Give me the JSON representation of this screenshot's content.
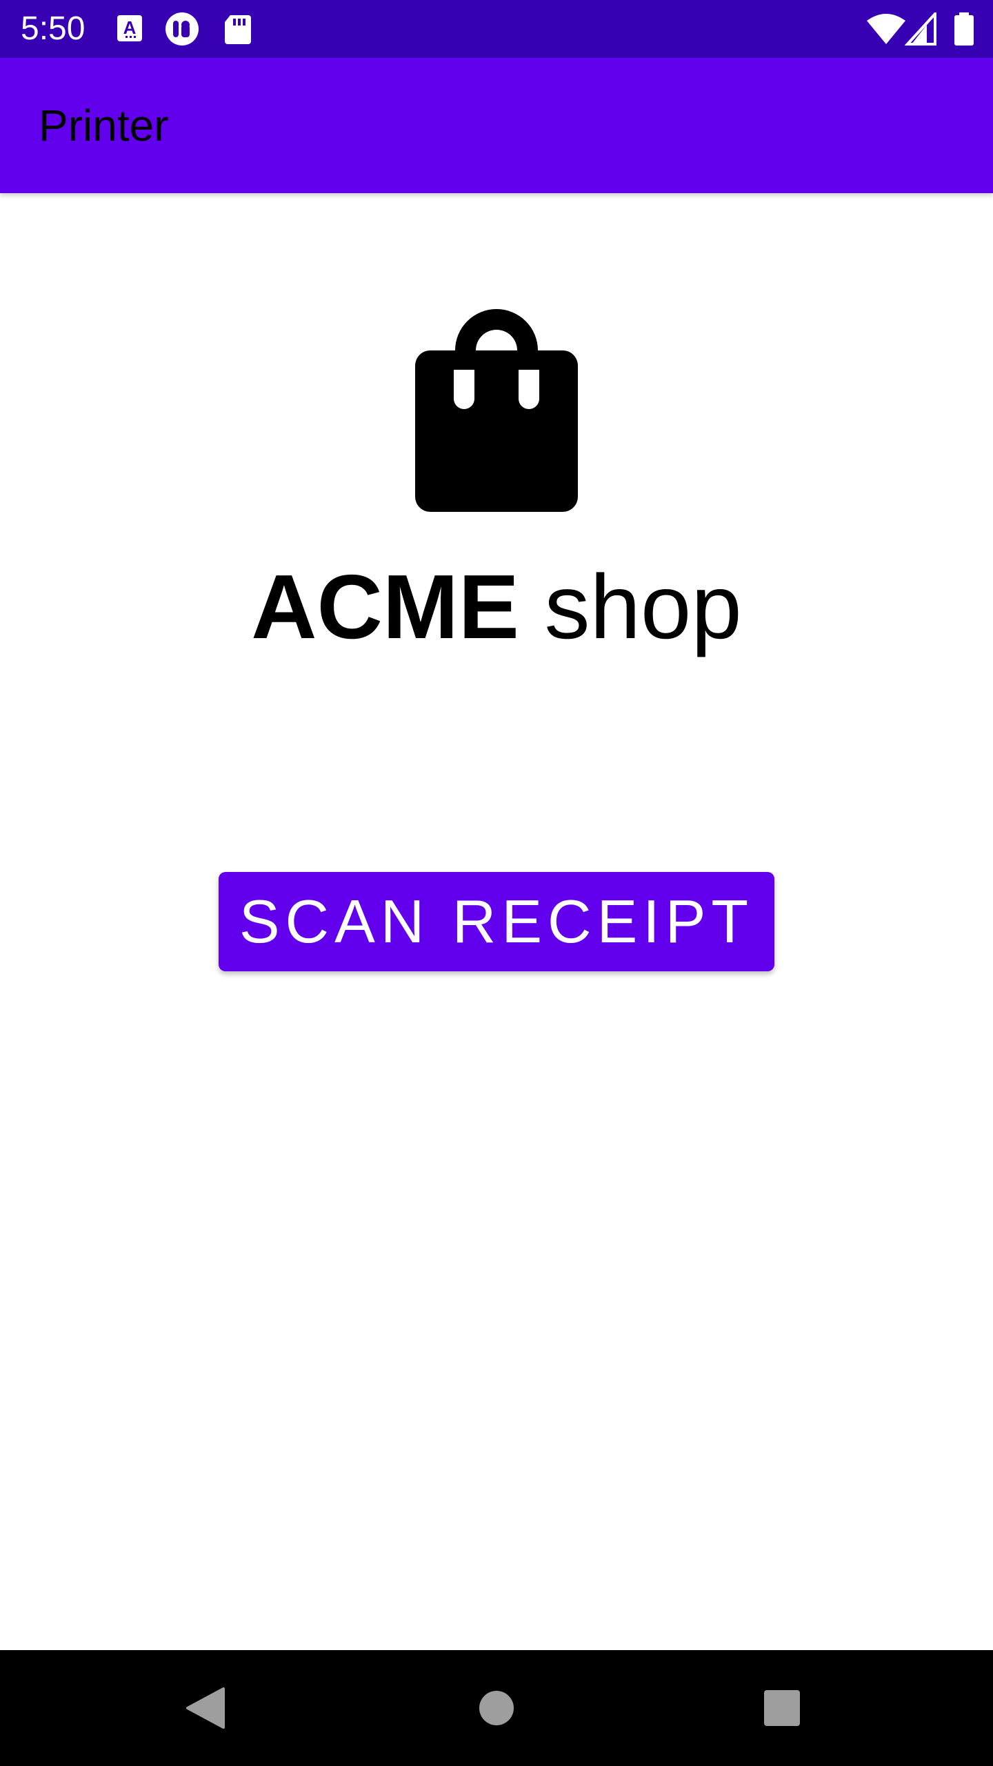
{
  "status_bar": {
    "time": "5:50",
    "icons": [
      "a-keyboard-icon",
      "notification-app-icon",
      "sd-card-icon",
      "wifi-icon",
      "signal-icon",
      "battery-icon"
    ]
  },
  "app_bar": {
    "title": "Printer"
  },
  "main": {
    "logo_icon": "shopping-bag-icon",
    "shop_title_brand": "ACME",
    "shop_title_suffix": " shop",
    "scan_button_label": "SCAN RECEIPT"
  },
  "nav_bar": {
    "icons": [
      "back-icon",
      "home-icon",
      "recents-icon"
    ]
  },
  "colors": {
    "status_bar": "#3700b3",
    "primary": "#6200ee",
    "on_primary": "#ffffff",
    "nav_bar": "#000000",
    "nav_icon": "#9e9e9e"
  }
}
